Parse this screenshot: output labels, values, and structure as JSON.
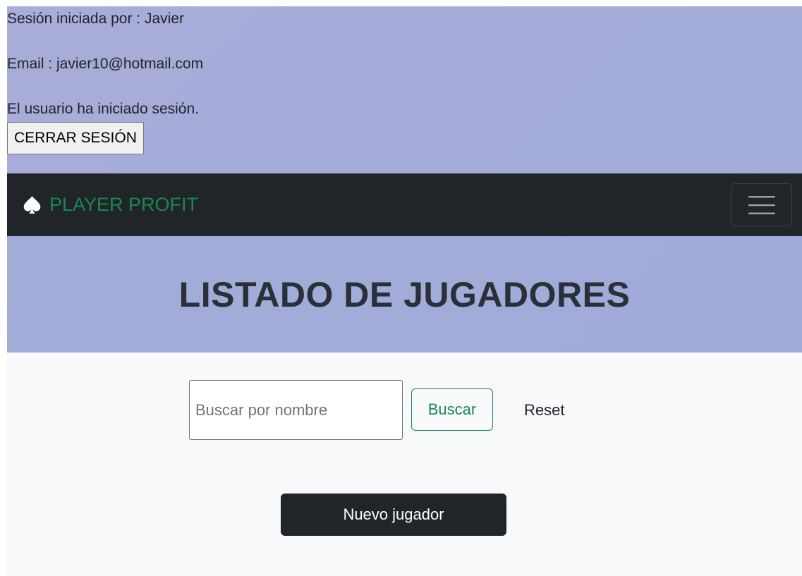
{
  "session": {
    "user_line": "Sesión iniciada por : Javier",
    "email_line": "Email : javier10@hotmail.com",
    "status_line": "El usuario ha iniciado sesión.",
    "logout_label": "CERRAR SESIÓN"
  },
  "navbar": {
    "brand_icon": "spade-icon",
    "brand_text": "PLAYER PROFIT",
    "toggler_icon": "hamburger-menu-icon"
  },
  "hero": {
    "title": "LISTADO DE JUGADORES"
  },
  "search": {
    "placeholder": "Buscar por nombre",
    "value": "",
    "submit_label": "Buscar",
    "reset_label": "Reset"
  },
  "actions": {
    "new_player_label": "Nuevo jugador"
  },
  "colors": {
    "band": "#a6acd9",
    "navbar": "#212529",
    "brand": "#198754",
    "page": "#f8f9fa"
  }
}
